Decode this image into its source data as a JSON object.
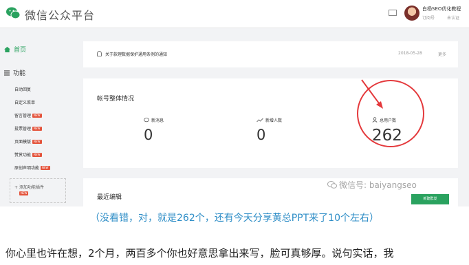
{
  "header": {
    "brand": "微信公众平台",
    "account_name": "白杨SEO优化教程",
    "account_type": "订阅号",
    "verify_status": "未认证"
  },
  "sidebar": {
    "home_label": "首页",
    "section_label": "功能",
    "items": [
      {
        "label": "自动回复",
        "new": ""
      },
      {
        "label": "自定义菜单",
        "new": ""
      },
      {
        "label": "留言管理",
        "new": "NEW"
      },
      {
        "label": "投票管理",
        "new": "NEW"
      },
      {
        "label": "页面模版",
        "new": "NEW"
      },
      {
        "label": "赞赏功能",
        "new": "NEW"
      },
      {
        "label": "原创声明功能",
        "new": "NEW"
      }
    ],
    "plugin_label": "添加功能插件",
    "plugin_new": "NEW"
  },
  "notice": {
    "text": "关于款理数据保护通用条例的通知",
    "date": "2018-05-28",
    "more": "更多"
  },
  "overview": {
    "title": "帐号整体情况",
    "stats": [
      {
        "label": "新消息",
        "value": "0"
      },
      {
        "label": "新增人数",
        "value": "0"
      },
      {
        "label": "总用户数",
        "value": "262"
      }
    ]
  },
  "recent": {
    "title": "最近编辑",
    "button": "新建群发"
  },
  "watermark": "微信号: baiyangseo",
  "caption": "（没看错，对，就是262个，还有今天分享黄总PPT来了10个左右）",
  "paragraph": "你心里也许在想，2个月，两百多个你也好意思拿出来写，脸可真够厚。说句实话，我",
  "colors": {
    "accent": "#2aa25f",
    "highlight": "#e4393c",
    "caption": "#2f8ec7"
  }
}
